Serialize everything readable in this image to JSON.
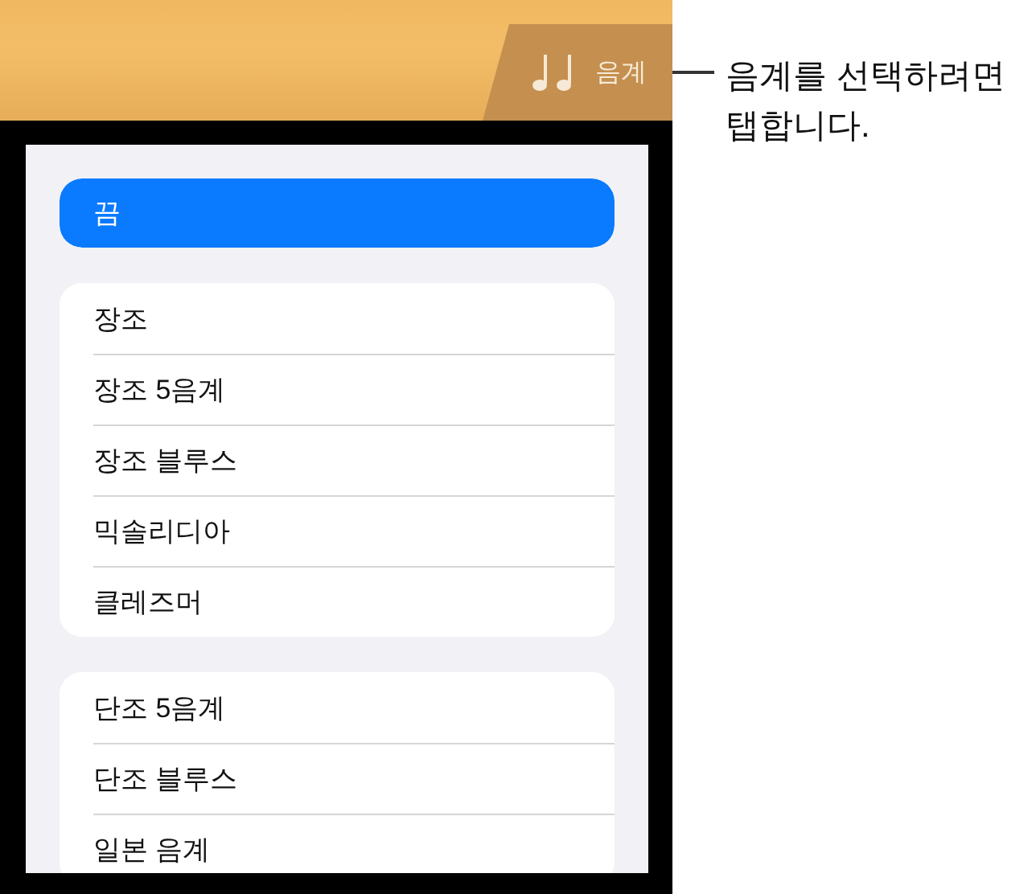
{
  "tab": {
    "label": "음계",
    "selected": true
  },
  "callout": "음계를 선택하려면 탭합니다.",
  "groups": [
    {
      "items": [
        {
          "label": "끔",
          "selected": true
        }
      ]
    },
    {
      "items": [
        {
          "label": "장조",
          "selected": false
        },
        {
          "label": "장조 5음계",
          "selected": false
        },
        {
          "label": "장조 블루스",
          "selected": false
        },
        {
          "label": "믹솔리디아",
          "selected": false
        },
        {
          "label": "클레즈머",
          "selected": false
        }
      ]
    },
    {
      "items": [
        {
          "label": "단조 5음계",
          "selected": false
        },
        {
          "label": "단조 블루스",
          "selected": false
        },
        {
          "label": "일본 음계",
          "selected": false
        }
      ]
    }
  ]
}
